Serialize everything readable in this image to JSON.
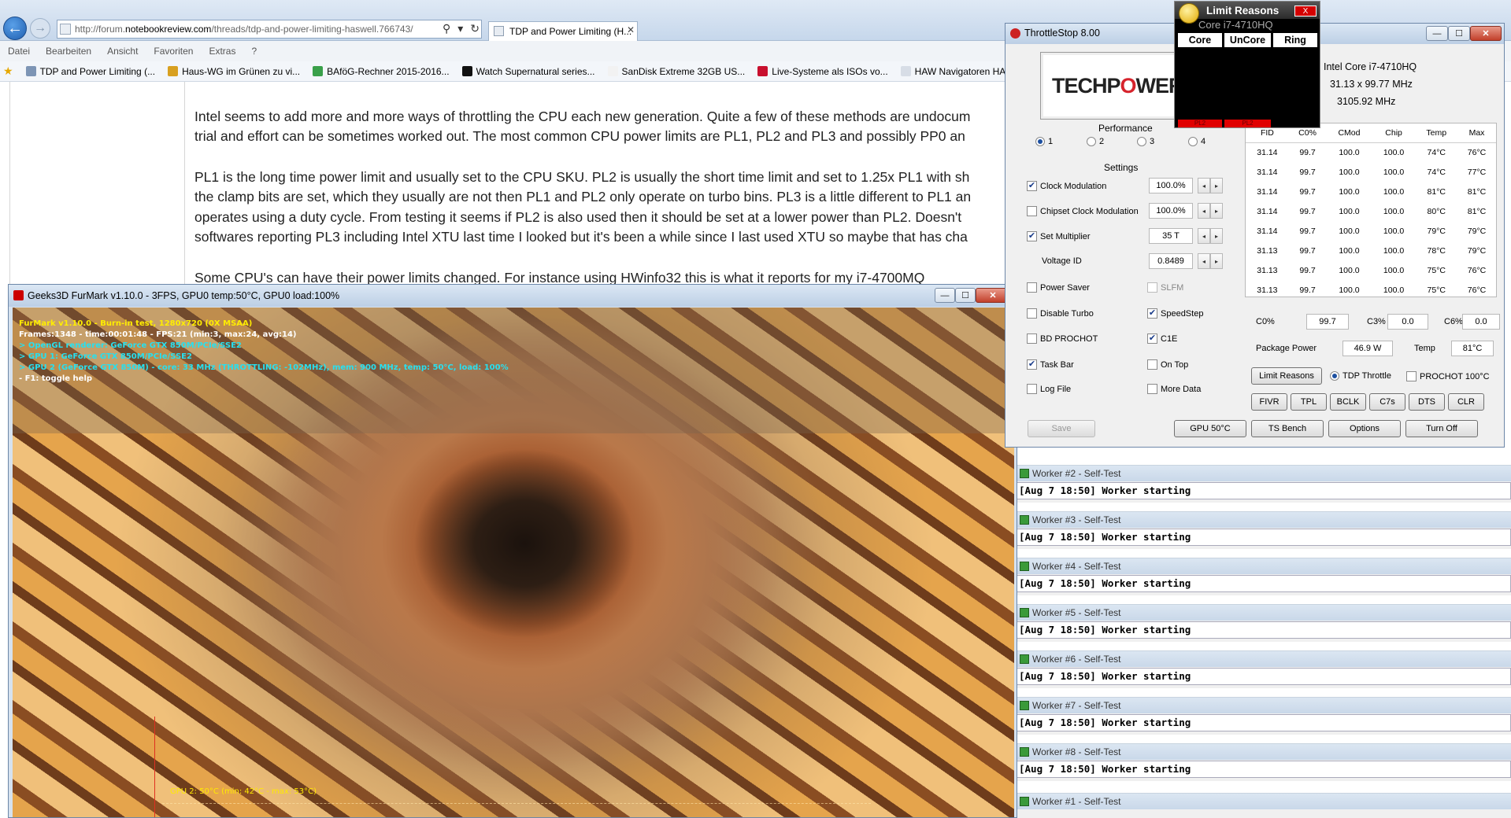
{
  "browser": {
    "address_scheme": "http://forum.",
    "address_domain": "notebookreview.com",
    "address_path": "/threads/tdp-and-power-limiting-haswell.766743/",
    "tab_title": "TDP and Power Limiting (H...",
    "menu": [
      "Datei",
      "Bearbeiten",
      "Ansicht",
      "Favoriten",
      "Extras",
      "?"
    ],
    "favorites": [
      {
        "label": "TDP and Power Limiting (...",
        "color": "#7d95b5"
      },
      {
        "label": "Haus-WG im Grünen zu vi...",
        "color": "#d8a020"
      },
      {
        "label": "BAföG-Rechner 2015-2016...",
        "color": "#3aa04a"
      },
      {
        "label": "Watch Supernatural series...",
        "color": "#111111"
      },
      {
        "label": "SanDisk Extreme 32GB US...",
        "color": "#f2f2f2"
      },
      {
        "label": "Live-Systeme als ISOs vo...",
        "color": "#c8102e"
      },
      {
        "label": "HAW Navigatoren HAW ...",
        "color": "#d7dde6"
      }
    ],
    "paragraphs": [
      "Intel seems to add more and more ways of throttling the CPU each new generation. Quite a few of these methods are undocum",
      "trial and effort can be sometimes worked out. The most common CPU power limits are PL1, PL2 and PL3 and possibly PP0 an",
      "PL1 is the long time power limit and usually set to the CPU SKU. PL2 is usually the short time limit and set to 1.25x PL1 with sh",
      "the clamp bits are set, which they usually are not then PL1 and PL2 only operate on turbo bins. PL3 is a little different to PL1 an",
      "operates using a duty cycle. From testing it seems if PL2 is also used then it should be set at a lower power than PL2. Doesn't",
      "softwares reporting PL3 including Intel XTU last time I looked but it's been a while since I last used XTU so maybe that has cha",
      "Some CPU's can have their power limits changed. For instance using HWinfo32 this is what it reports for my i7-4700MQ"
    ]
  },
  "furmark": {
    "title": "Geeks3D FurMark v1.10.0 - 3FPS, GPU0 temp:50°C, GPU0 load:100%",
    "lines": [
      {
        "text": "FurMark v1.10.0 - Burn-in test, 1280x720 (0X MSAA)",
        "color": "#ffee00"
      },
      {
        "text": "Frames:1348 - time:00:01:48 - FPS:21 (min:3, max:24, avg:14)",
        "color": "#ffffff"
      },
      {
        "text": "> OpenGL renderer: GeForce GTX 850M/PCIe/SSE2",
        "color": "#27e0f0"
      },
      {
        "text": "> GPU 1: GeForce GTX 850M/PCIe/SSE2",
        "color": "#27e0f0"
      },
      {
        "text": "> GPU 2 (GeForce GTX 850M) - core: 33 MHz (THROTTLING: -102MHz), mem: 900 MHz, temp: 50°C, load: 100%",
        "color": "#27e0f0"
      },
      {
        "text": "- F1: toggle help",
        "color": "#ffffff"
      }
    ],
    "graph_label": "GPU 2: 50°C (min: 42°C - max: 53°C)"
  },
  "throttlestop": {
    "title": "ThrottleStop 8.00",
    "logo_a": "TECHP",
    "logo_o": "O",
    "logo_b": "WER",
    "cpu_name": "Intel Core i7-4710HQ",
    "multiplier": "31.13 x 99.77 MHz",
    "freq": "3105.92 MHz",
    "performance_label": "Performance",
    "profiles": [
      "1",
      "2",
      "3",
      "4"
    ],
    "settings_label": "Settings",
    "clock_mod_label": "Clock Modulation",
    "clock_mod_value": "100.0%",
    "chipset_mod_label": "Chipset Clock Modulation",
    "chipset_mod_value": "100.0%",
    "set_mult_label": "Set Multiplier",
    "set_mult_value": "35 T",
    "voltage_label": "Voltage ID",
    "voltage_value": "0.8489",
    "power_saver": "Power Saver",
    "slfm": "SLFM",
    "disable_turbo": "Disable Turbo",
    "speedstep": "SpeedStep",
    "bd_prochot": "BD PROCHOT",
    "c1e": "C1E",
    "task_bar": "Task Bar",
    "on_top": "On Top",
    "log_file": "Log File",
    "more_data": "More Data",
    "table_headers": [
      "FID",
      "C0%",
      "CMod",
      "Chip",
      "Temp",
      "Max"
    ],
    "table_rows": [
      [
        "31.14",
        "99.7",
        "100.0",
        "100.0",
        "74°C",
        "76°C"
      ],
      [
        "31.14",
        "99.7",
        "100.0",
        "100.0",
        "74°C",
        "77°C"
      ],
      [
        "31.14",
        "99.7",
        "100.0",
        "100.0",
        "81°C",
        "81°C"
      ],
      [
        "31.14",
        "99.7",
        "100.0",
        "100.0",
        "80°C",
        "81°C"
      ],
      [
        "31.14",
        "99.7",
        "100.0",
        "100.0",
        "79°C",
        "79°C"
      ],
      [
        "31.13",
        "99.7",
        "100.0",
        "100.0",
        "78°C",
        "79°C"
      ],
      [
        "31.13",
        "99.7",
        "100.0",
        "100.0",
        "75°C",
        "76°C"
      ],
      [
        "31.13",
        "99.7",
        "100.0",
        "100.0",
        "75°C",
        "76°C"
      ]
    ],
    "c0_label": "C0%",
    "c0_value": "99.7",
    "c3_label": "C3%",
    "c3_value": "0.0",
    "c6_label": "C6%",
    "c6_value": "0.0",
    "pkg_label": "Package Power",
    "pkg_value": "46.9 W",
    "temp_label": "Temp",
    "temp_value": "81°C",
    "limit_reasons_btn": "Limit Reasons",
    "tdp_throttle": "TDP Throttle",
    "prochot": "PROCHOT 100°C",
    "small_buttons": [
      "FIVR",
      "TPL",
      "BCLK",
      "C7s",
      "DTS",
      "CLR"
    ],
    "save": "Save",
    "gpu_btn": "GPU 50°C",
    "ts_bench": "TS Bench",
    "options": "Options",
    "turn_off": "Turn Off"
  },
  "limit_reasons": {
    "title": "Limit Reasons",
    "close": "X",
    "cpu": "Core i7-4710HQ",
    "tabs": [
      "Core",
      "UnCore",
      "Ring"
    ],
    "pl_labels": [
      "PL2",
      "PL2"
    ]
  },
  "workers": [
    {
      "title": "Worker #2 - Self-Test",
      "msg": "[Aug 7 18:50] Worker starting"
    },
    {
      "title": "Worker #3 - Self-Test",
      "msg": "[Aug 7 18:50] Worker starting"
    },
    {
      "title": "Worker #4 - Self-Test",
      "msg": "[Aug 7 18:50] Worker starting"
    },
    {
      "title": "Worker #5 - Self-Test",
      "msg": "[Aug 7 18:50] Worker starting"
    },
    {
      "title": "Worker #6 - Self-Test",
      "msg": "[Aug 7 18:50] Worker starting"
    },
    {
      "title": "Worker #7 - Self-Test",
      "msg": "[Aug 7 18:50] Worker starting"
    },
    {
      "title": "Worker #8 - Self-Test",
      "msg": "[Aug 7 18:50] Worker starting"
    },
    {
      "title": "Worker #1 - Self-Test",
      "msg": ""
    }
  ]
}
